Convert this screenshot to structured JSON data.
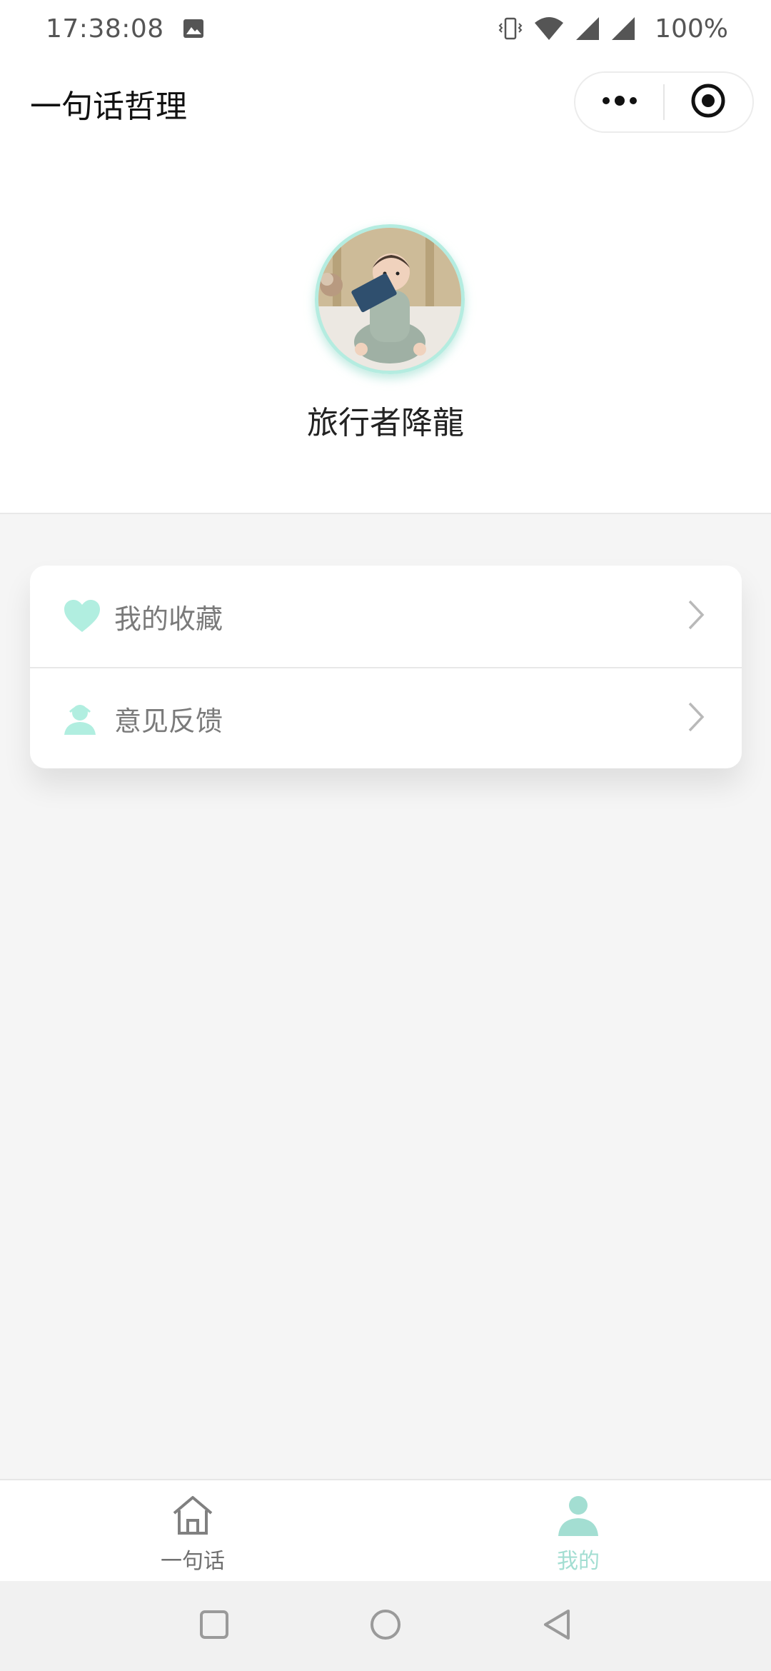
{
  "status_bar": {
    "time": "17:38:08",
    "battery": "100%",
    "icons": [
      "image-icon",
      "vibrate-icon",
      "wifi-icon",
      "signal-icon",
      "signal-icon"
    ]
  },
  "header": {
    "title": "一句话哲理",
    "capsule_icons": [
      "more-dots-icon",
      "target-close-icon"
    ]
  },
  "profile": {
    "username": "旅行者降龍",
    "avatar_border_color": "#b4ece0"
  },
  "menu": {
    "items": [
      {
        "label": "我的收藏",
        "icon": "heart-icon"
      },
      {
        "label": "意见反馈",
        "icon": "support-agent-icon"
      }
    ]
  },
  "tab_bar": {
    "tabs": [
      {
        "label": "一句话",
        "icon": "home-icon",
        "active": false
      },
      {
        "label": "我的",
        "icon": "user-icon",
        "active": true
      }
    ],
    "active_color": "#a3ded2",
    "inactive_color": "#707070"
  },
  "accent_color": "#b4ece0",
  "nav_bar": {
    "buttons": [
      "recent-apps-icon",
      "home-circle-icon",
      "back-icon"
    ]
  }
}
